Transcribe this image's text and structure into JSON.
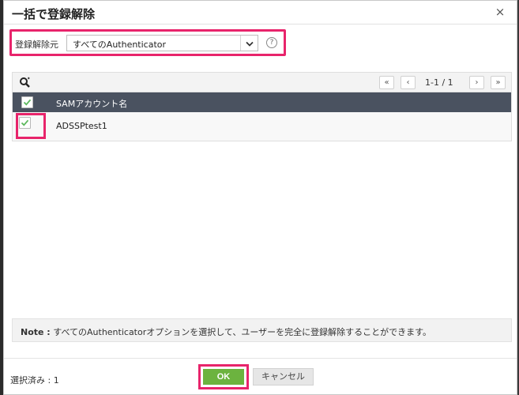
{
  "dialog": {
    "title": "一括で登録解除",
    "close_glyph": "×"
  },
  "source": {
    "label": "登録解除元",
    "selected": "すべてのAuthenticator",
    "help_glyph": "?"
  },
  "grid": {
    "pager": {
      "first": "«",
      "prev": "‹",
      "range": "1-1 / 1",
      "next": "›",
      "last": "»"
    },
    "column_header": "SAMアカウント名",
    "rows": [
      {
        "label": "ADSSPtest1",
        "checked": true
      }
    ]
  },
  "note": {
    "label": "Note :",
    "text": "すべてのAuthenticatorオプションを選択して、ユーザーを完全に登録解除することができます。"
  },
  "footer": {
    "selected_count": "選択済み : 1",
    "ok_label": "OK",
    "cancel_label": "キャンセル"
  },
  "colors": {
    "highlight": "#e8246b",
    "ok_green": "#6cb33f",
    "header_dark": "#4a5260",
    "check_green": "#5cb85c"
  }
}
